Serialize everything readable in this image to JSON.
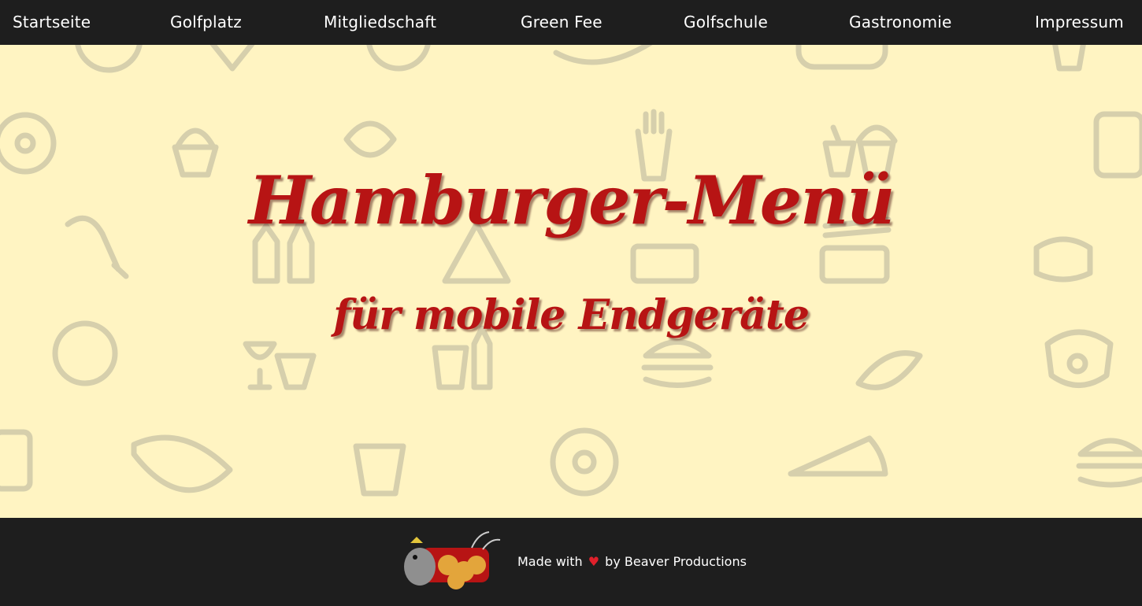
{
  "nav": {
    "items": [
      {
        "label": "Startseite"
      },
      {
        "label": "Golfplatz"
      },
      {
        "label": "Mitgliedschaft"
      },
      {
        "label": "Green Fee"
      },
      {
        "label": "Golfschule"
      },
      {
        "label": "Gastronomie"
      },
      {
        "label": "Impressum"
      }
    ]
  },
  "hero": {
    "title": "Hamburger-Menü",
    "subtitle": "für mobile Endgeräte"
  },
  "footer": {
    "made_with": "Made with",
    "heart": "♥",
    "by": "by Beaver Productions"
  },
  "colors": {
    "nav_bg": "#1e1e1e",
    "hero_bg": "#fff4c2",
    "title": "#b71414",
    "heart": "#e0202b",
    "pattern": "#d6cfac"
  }
}
